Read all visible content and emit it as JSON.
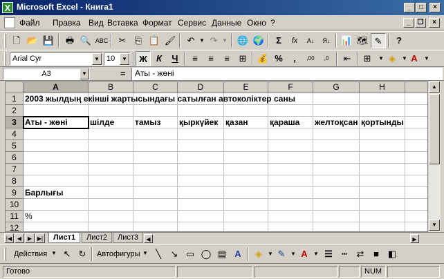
{
  "window": {
    "title": "Microsoft Excel - Книга1",
    "app_icon": "X"
  },
  "menu": [
    "Файл",
    "Правка",
    "Вид",
    "Вставка",
    "Формат",
    "Сервис",
    "Данные",
    "Окно",
    "?"
  ],
  "format_toolbar": {
    "font": "Arial Cyr",
    "size": "10",
    "bold": "Ж",
    "italic": "К",
    "underline": "Ч"
  },
  "formula_bar": {
    "name_box": "A3",
    "equals": "=",
    "content": "Аты - жөні"
  },
  "columns": [
    "A",
    "B",
    "C",
    "D",
    "E",
    "F",
    "G",
    "H"
  ],
  "rows": [
    "1",
    "2",
    "3",
    "4",
    "5",
    "6",
    "7",
    "8",
    "9",
    "10",
    "11",
    "12"
  ],
  "cells": {
    "r1": "2003 жылдың екінші жартысындағы сатылған автоколіктер саны",
    "r3": [
      "Аты - жөні",
      "шілде",
      "тамыз",
      "қыркүйек",
      "қазан",
      "қараша",
      "желтоқсан",
      "қортынды"
    ],
    "r9": "Барлығы",
    "r11": "%"
  },
  "sheets": [
    "Лист1",
    "Лист2",
    "Лист3"
  ],
  "draw_toolbar": {
    "actions": "Действия",
    "autoshapes": "Автофигуры"
  },
  "status": {
    "ready": "Готово",
    "num": "NUM"
  }
}
